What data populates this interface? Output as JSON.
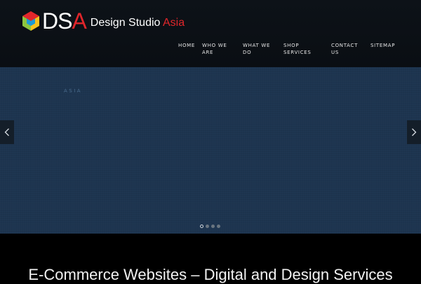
{
  "brand": {
    "logo_letters_white": "DS",
    "logo_letters_red": "A",
    "name_white": "Design Studio ",
    "name_red": "Asia",
    "accent_color": "#e1262b"
  },
  "nav": {
    "items": [
      {
        "label": "HOME"
      },
      {
        "label": "WHO WE\nARE"
      },
      {
        "label": "WHAT WE\nDO"
      },
      {
        "label": "SHOP\nSERVICES"
      },
      {
        "label": "CONTACT\nUS"
      },
      {
        "label": "SITEMAP"
      }
    ]
  },
  "slider": {
    "caption": "ASIA",
    "background_color": "#1d3550",
    "prev_icon": "chevron-left-icon",
    "next_icon": "chevron-right-icon",
    "slide_count": 4,
    "active_slide": 1
  },
  "section": {
    "title": "E-Commerce Websites – Digital and Design Services"
  }
}
